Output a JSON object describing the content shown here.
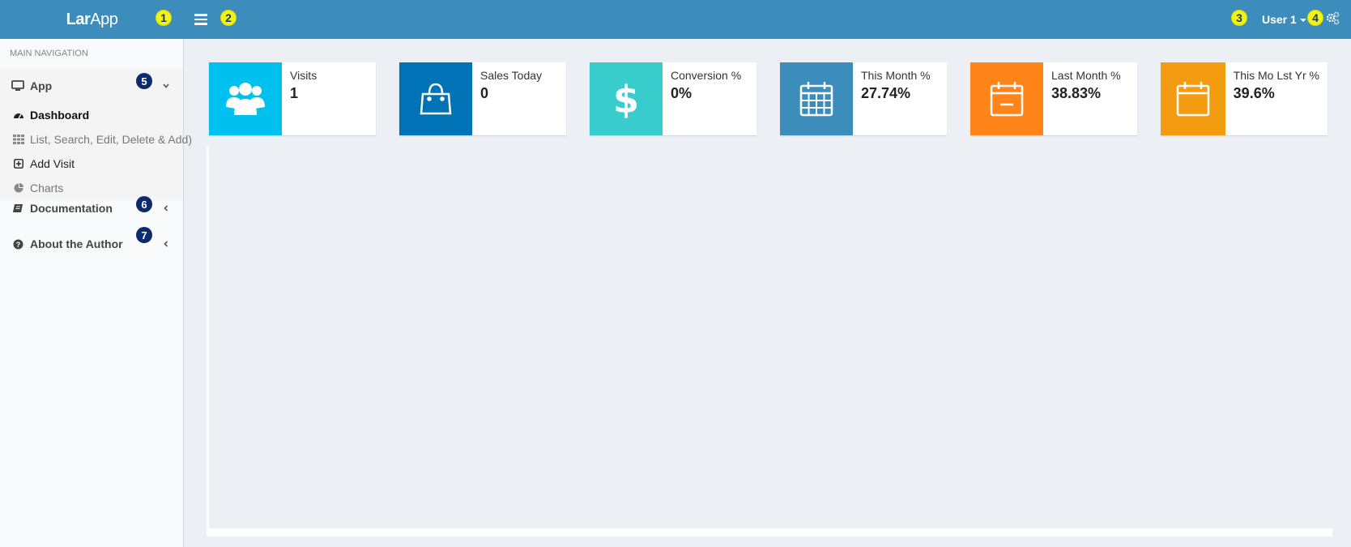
{
  "header": {
    "logo_bold": "Lar",
    "logo_thin": "App",
    "user_label": "User 1",
    "annotations": [
      "1",
      "2",
      "3",
      "4"
    ]
  },
  "sidebar": {
    "nav_header": "MAIN NAVIGATION",
    "app_label": "App",
    "app_icon": "monitor-icon",
    "submenu": [
      {
        "label": "Dashboard",
        "icon": "dashboard-icon"
      },
      {
        "label": "List, Search, Edit, Delete & Add)",
        "icon": "grid-icon"
      },
      {
        "label": "Add Visit",
        "icon": "plus-square-icon"
      },
      {
        "label": "Charts",
        "icon": "pie-chart-icon"
      }
    ],
    "documentation_label": "Documentation",
    "author_label": "About the Author",
    "annotations": [
      "5",
      "6",
      "7"
    ]
  },
  "info_boxes": [
    {
      "label": "Visits",
      "value": "1",
      "color": "#00c0ef",
      "icon": "users-icon"
    },
    {
      "label": "Sales Today",
      "value": "0",
      "color": "#0073b7",
      "icon": "shopping-bag-icon"
    },
    {
      "label": "Conversion %",
      "value": "0%",
      "color": "#39cccc",
      "icon": "dollar-icon"
    },
    {
      "label": "This Month %",
      "value": "27.74%",
      "color": "#3c8dbc",
      "icon": "calendar-icon"
    },
    {
      "label": "Last Month %",
      "value": "38.83%",
      "color": "#ff851b",
      "icon": "calendar-minus-icon"
    },
    {
      "label": "This Mo Lst Yr %",
      "value": "39.6%",
      "color": "#f39c12",
      "icon": "calendar-blank-icon"
    }
  ]
}
